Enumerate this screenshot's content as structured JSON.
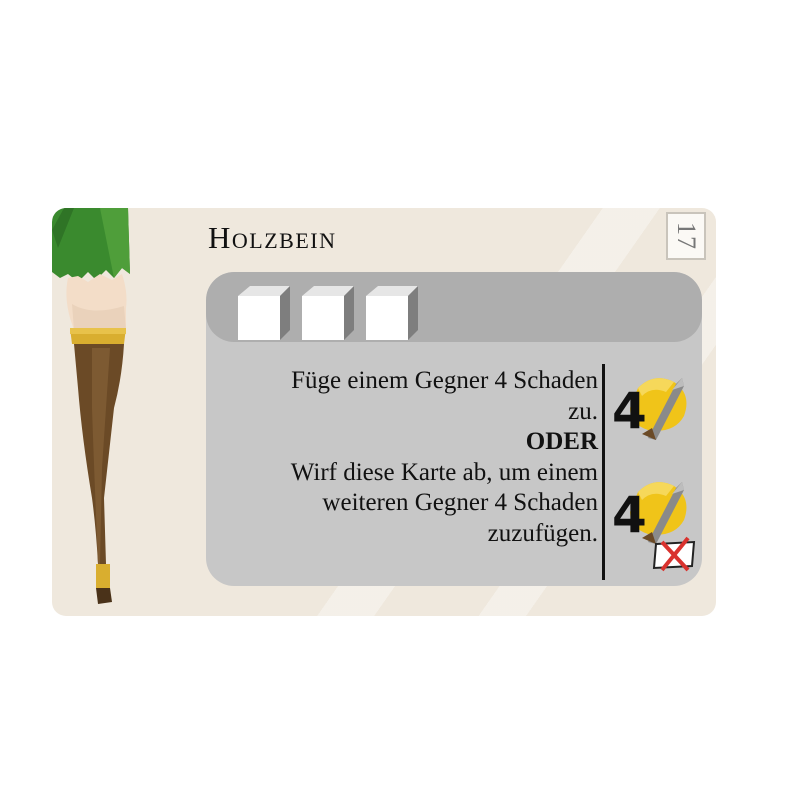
{
  "card": {
    "title": "Holzbein",
    "number": "17",
    "cost_slots": 3,
    "text_lines": [
      "Füge einem Gegner 4 Schaden",
      "zu."
    ],
    "separator": "ODER",
    "text_lines_2": [
      "Wirf diese Karte ab, um einem",
      "weiteren Gegner 4 Schaden",
      "zuzufügen."
    ],
    "effects": [
      {
        "damage": "4",
        "icon": "melee-attack-icon"
      },
      {
        "damage": "4",
        "icon": "melee-attack-discard-icon"
      }
    ],
    "colors": {
      "card_bg": "#efe8dd",
      "panel": "#c7c7c7",
      "panel_top": "#aeaeae",
      "leaf_green": "#3a8a2e",
      "wood": "#6b4a26",
      "gold_band": "#d9ae2f",
      "attack_yellow": "#f0c419",
      "discard_x": "#d9322e"
    }
  }
}
